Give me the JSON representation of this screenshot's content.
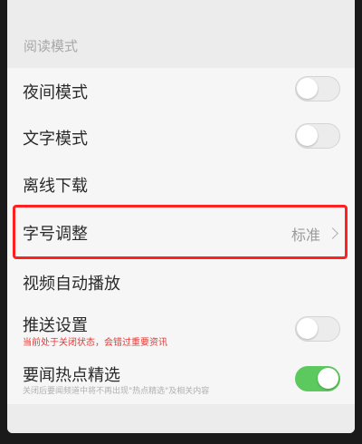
{
  "section": {
    "title": "阅读模式"
  },
  "settings": {
    "night_mode": {
      "label": "夜间模式",
      "enabled": false
    },
    "text_mode": {
      "label": "文字模式",
      "enabled": false
    },
    "offline_download": {
      "label": "离线下载"
    },
    "font_size": {
      "label": "字号调整",
      "value": "标准"
    },
    "video_autoplay": {
      "label": "视频自动播放"
    },
    "push_settings": {
      "label": "推送设置",
      "note": "当前处于关闭状态，会错过重要资讯",
      "enabled": false
    },
    "hot_news": {
      "label": "要闻热点精选",
      "note": "关闭后要闻频道中将不再出现\"热点精选\"及相关内容",
      "enabled": true
    }
  },
  "colors": {
    "toggle_on": "#5cc95e",
    "warning_text": "#e53935",
    "highlight": "#ff2020"
  }
}
